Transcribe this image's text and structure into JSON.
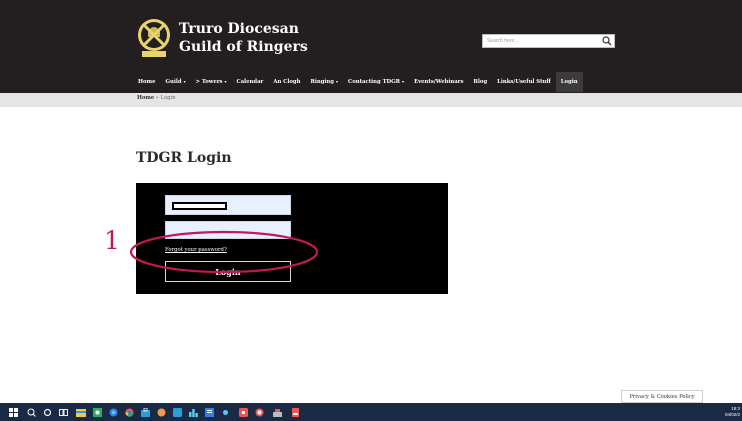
{
  "site": {
    "name_line1": "Truro Diocesan",
    "name_line2": "Guild of Ringers",
    "search_placeholder": "Search here..."
  },
  "nav": {
    "items": [
      {
        "label": "Home",
        "dropdown": false
      },
      {
        "label": "Guild",
        "dropdown": true
      },
      {
        "label": "> Towers",
        "dropdown": true
      },
      {
        "label": "Calendar",
        "dropdown": false
      },
      {
        "label": "An Clogh",
        "dropdown": false
      },
      {
        "label": "Ringing",
        "dropdown": true
      },
      {
        "label": "Contacting TDGR",
        "dropdown": true
      },
      {
        "label": "Events/Webinars",
        "dropdown": false
      },
      {
        "label": "Blog",
        "dropdown": false
      },
      {
        "label": "Links/Useful Stuff",
        "dropdown": false
      },
      {
        "label": "Login",
        "dropdown": false,
        "active": true
      }
    ]
  },
  "breadcrumb": {
    "home": "Home",
    "separator": " » ",
    "current": "Login"
  },
  "page": {
    "title": "TDGR Login"
  },
  "login_form": {
    "forgot_label": "Forgot your password?",
    "submit_label": "Login"
  },
  "annotation": {
    "number": "1",
    "color": "#c2185b"
  },
  "cookie": {
    "label": "Privacy & Cookies Policy"
  },
  "taskbar": {
    "clock_time": "18:3",
    "clock_date": "04/02/2"
  },
  "colors": {
    "header_bg": "#231f20",
    "panel_bg": "#000000",
    "field_bg": "#e8f0fe",
    "taskbar_bg": "#1b2a44"
  }
}
